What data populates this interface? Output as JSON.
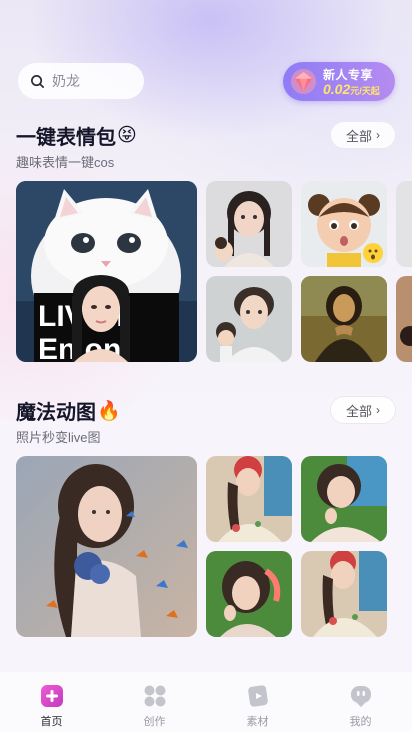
{
  "search": {
    "placeholder": "奶龙"
  },
  "promo": {
    "title": "新人专享",
    "price": "0.02",
    "unit": "元/天起"
  },
  "sections": [
    {
      "title": "一键表情包",
      "title_emoji": "😝",
      "subtitle": "趣味表情一键cos",
      "all_label": "全部",
      "featured_text_line1": "LIV    AT",
      "featured_text_line2": "En        on"
    },
    {
      "title": "魔法动图",
      "title_emoji": "🔥",
      "subtitle": "照片秒变live图",
      "all_label": "全部"
    }
  ],
  "tabbar": {
    "items": [
      {
        "label": "首页",
        "icon": "home-plus-icon",
        "active": true
      },
      {
        "label": "创作",
        "icon": "grid-dots-icon",
        "active": false
      },
      {
        "label": "素材",
        "icon": "material-card-icon",
        "active": false
      },
      {
        "label": "我的",
        "icon": "profile-face-icon",
        "active": false
      }
    ]
  },
  "colors": {
    "accent": "#e040c8",
    "promo_gradient_start": "#8e7cf6",
    "promo_price": "#ffe46b"
  }
}
